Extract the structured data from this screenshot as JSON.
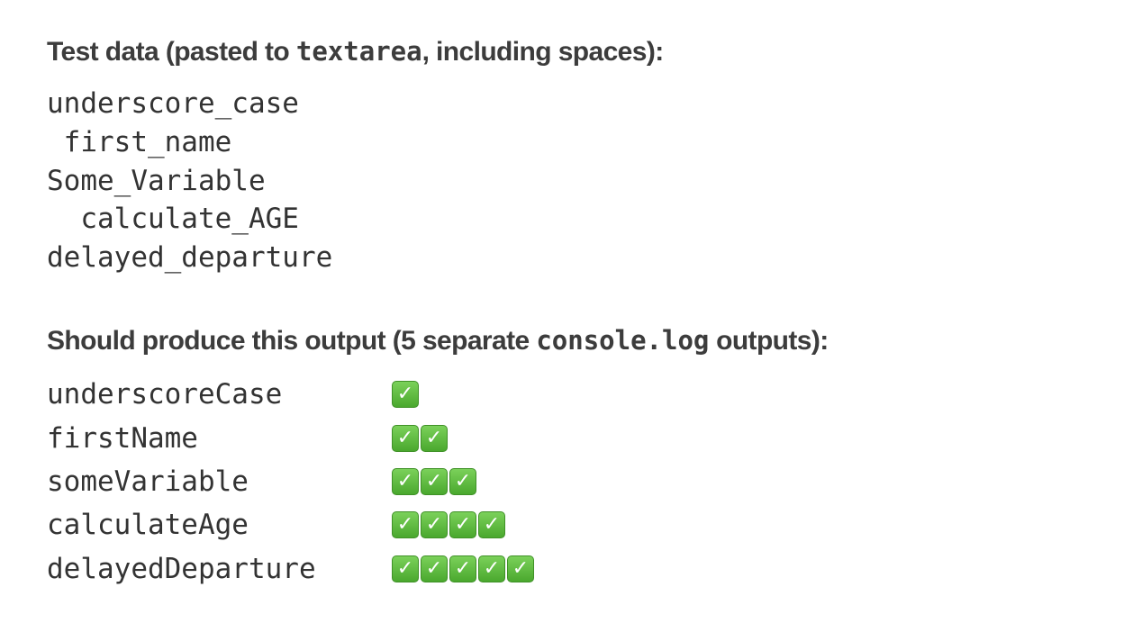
{
  "input_heading": {
    "prefix": "Test data (pasted to ",
    "code": "textarea",
    "suffix": ", including spaces):"
  },
  "input_lines": [
    "underscore_case",
    " first_name",
    "Some_Variable",
    "  calculate_AGE",
    "delayed_departure"
  ],
  "output_heading": {
    "prefix": "Should produce this output (5 separate ",
    "code": "console.log",
    "suffix": " outputs):"
  },
  "output_rows": [
    {
      "name": "underscoreCase",
      "checks": 1
    },
    {
      "name": "firstName",
      "checks": 2
    },
    {
      "name": "someVariable",
      "checks": 3
    },
    {
      "name": "calculateAge",
      "checks": 4
    },
    {
      "name": "delayedDeparture",
      "checks": 5
    }
  ],
  "icons": {
    "check": "white-heavy-check-mark-icon"
  },
  "colors": {
    "text": "#333333",
    "check_green": "#5cbf3c"
  }
}
